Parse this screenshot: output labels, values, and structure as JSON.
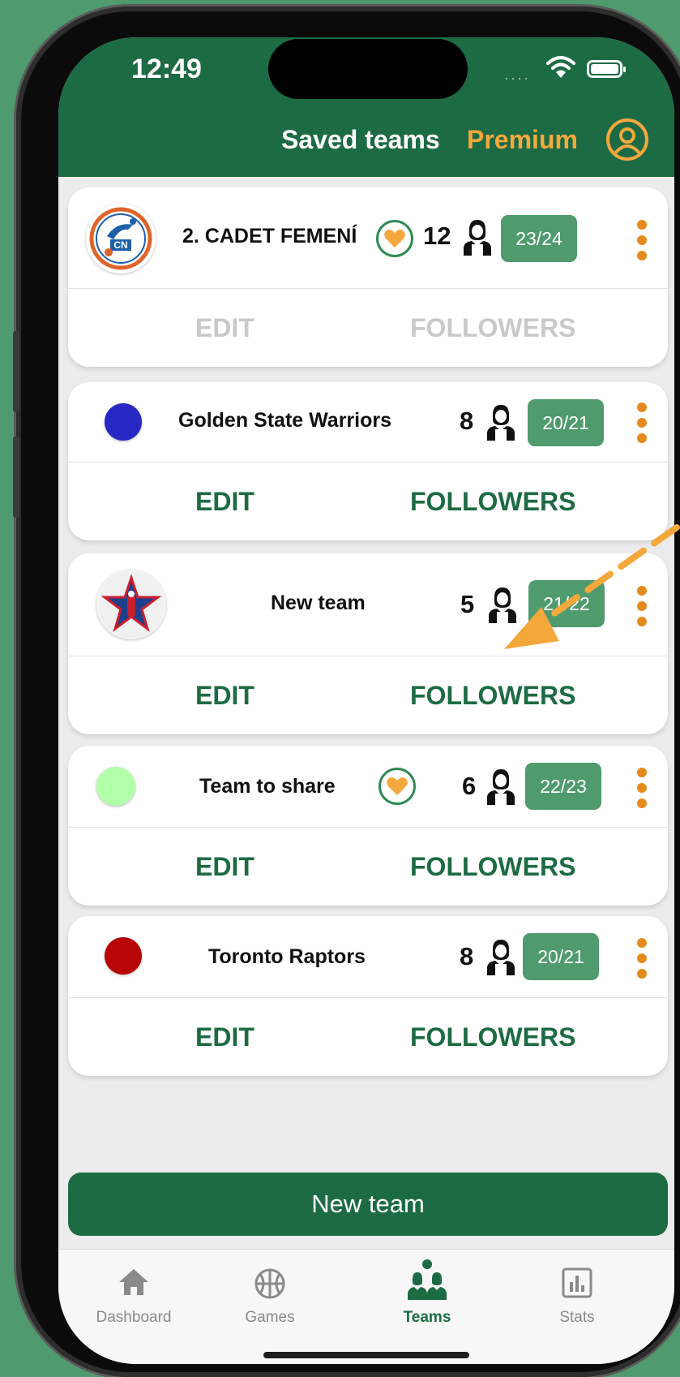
{
  "status_bar": {
    "time": "12:49"
  },
  "header": {
    "title": "Saved teams",
    "premium_label": "Premium"
  },
  "teams": [
    {
      "name": "2. CADET FEMENÍ",
      "followers": "12",
      "season": "23/24",
      "favorite": true,
      "logo": "club-crest-logo",
      "edit_label": "EDIT",
      "followers_label": "FOLLOWERS",
      "actions_enabled": false
    },
    {
      "name": "Golden State Warriors",
      "followers": "8",
      "season": "20/21",
      "favorite": false,
      "color": "#2727c4",
      "edit_label": "EDIT",
      "followers_label": "FOLLOWERS",
      "actions_enabled": true
    },
    {
      "name": "New team",
      "followers": "5",
      "season": "21/22",
      "favorite": false,
      "logo": "all-star-logo",
      "edit_label": "EDIT",
      "followers_label": "FOLLOWERS",
      "actions_enabled": true
    },
    {
      "name": "Team to share",
      "followers": "6",
      "season": "22/23",
      "favorite": true,
      "color": "#b1ffa8",
      "edit_label": "EDIT",
      "followers_label": "FOLLOWERS",
      "actions_enabled": true
    },
    {
      "name": "Toronto Raptors",
      "followers": "8",
      "season": "20/21",
      "favorite": false,
      "color": "#b80606",
      "edit_label": "EDIT",
      "followers_label": "FOLLOWERS",
      "actions_enabled": true
    }
  ],
  "new_team_button": "New team",
  "tabs": [
    {
      "label": "Dashboard",
      "icon": "home-icon",
      "active": false
    },
    {
      "label": "Games",
      "icon": "basketball-icon",
      "active": false
    },
    {
      "label": "Teams",
      "icon": "teams-icon",
      "active": true
    },
    {
      "label": "Stats",
      "icon": "stats-icon",
      "active": false
    }
  ],
  "colors": {
    "primary": "#1d6b44",
    "accent": "#f4a83c",
    "season_badge": "#4f9b6e",
    "background": "#4f9a6e"
  }
}
